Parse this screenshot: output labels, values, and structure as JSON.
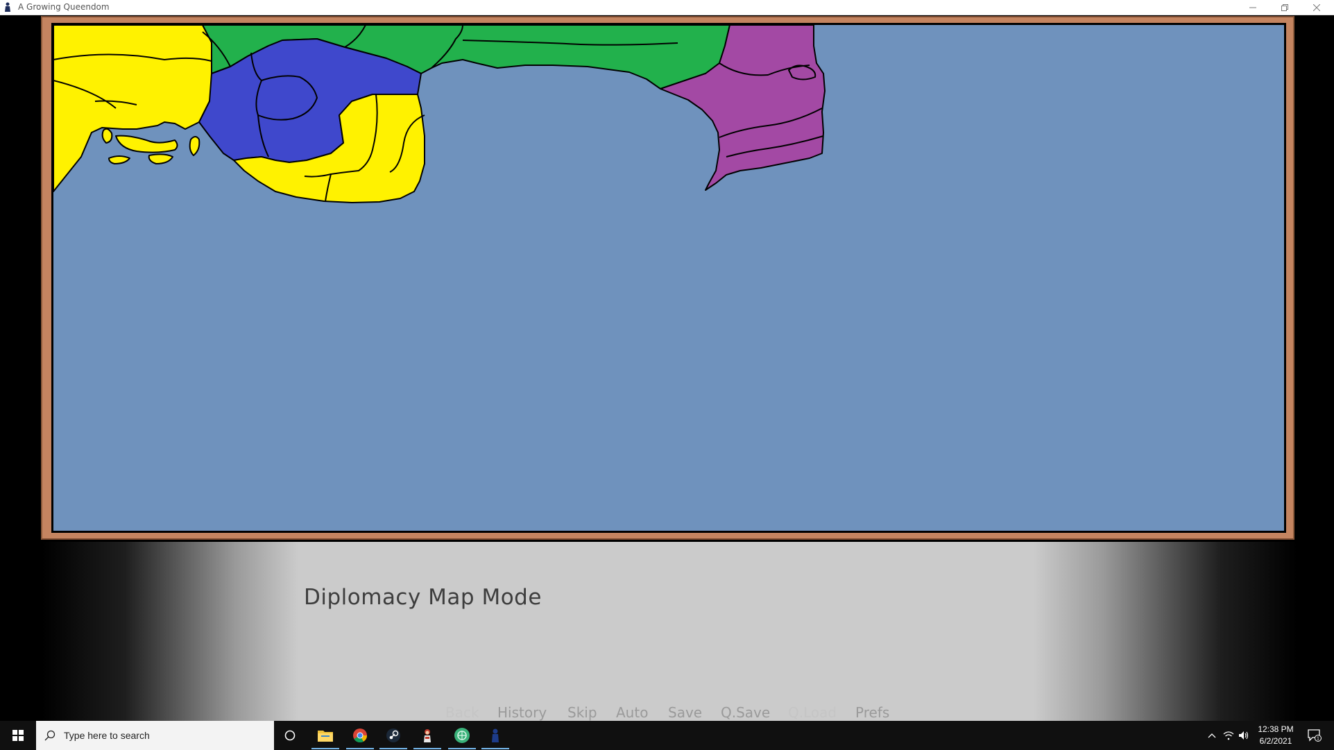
{
  "window": {
    "title": "A Growing Queendom",
    "icons": {
      "app": "queendom-app-icon",
      "minimize": "minimize-icon",
      "restore": "restore-icon",
      "close": "close-icon"
    }
  },
  "map": {
    "ocean_color": "#6f92bd",
    "frame_color": "#c48460",
    "region_colors": {
      "yellow": "#fff200",
      "green": "#22b14c",
      "blue": "#3f48cc",
      "purple": "#a349a4"
    }
  },
  "dialogue": {
    "text": "Diplomacy Map Mode"
  },
  "quick_menu": [
    {
      "label": "Back",
      "enabled": false
    },
    {
      "label": "History",
      "enabled": true
    },
    {
      "label": "Skip",
      "enabled": true
    },
    {
      "label": "Auto",
      "enabled": true
    },
    {
      "label": "Save",
      "enabled": true
    },
    {
      "label": "Q.Save",
      "enabled": true
    },
    {
      "label": "Q.Load",
      "enabled": false
    },
    {
      "label": "Prefs",
      "enabled": true
    }
  ],
  "taskbar": {
    "search_placeholder": "Type here to search",
    "apps": [
      "cortana-icon",
      "file-explorer-icon",
      "chrome-icon",
      "steam-icon",
      "game-character-icon",
      "green-app-icon",
      "queendom-app-icon"
    ],
    "clock_time": "12:38 PM",
    "clock_date": "6/2/2021",
    "notification_count": "1"
  }
}
